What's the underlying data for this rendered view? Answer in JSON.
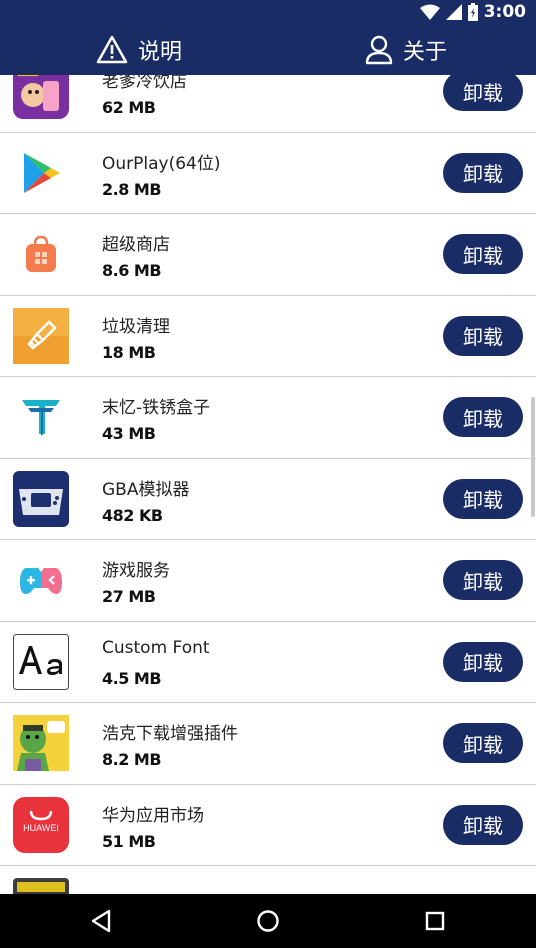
{
  "status": {
    "time": "3:00"
  },
  "header": {
    "left_label": "说明",
    "right_label": "关于"
  },
  "apps": [
    {
      "name": "老爹冷饮店",
      "size": "62 MB",
      "action": "卸载",
      "icon": "papas-cafe-icon"
    },
    {
      "name": "OurPlay(64位)",
      "size": "2.8 MB",
      "action": "卸载",
      "icon": "play-triangle-icon"
    },
    {
      "name": "超级商店",
      "size": "8.6 MB",
      "action": "卸载",
      "icon": "shopping-bag-icon"
    },
    {
      "name": "垃圾清理",
      "size": "18 MB",
      "action": "卸载",
      "icon": "broom-icon"
    },
    {
      "name": "末忆-铁锈盒子",
      "size": "43 MB",
      "action": "卸载",
      "icon": "t-logo-icon"
    },
    {
      "name": "GBA模拟器",
      "size": "482 KB",
      "action": "卸载",
      "icon": "gameboy-icon"
    },
    {
      "name": "游戏服务",
      "size": "27 MB",
      "action": "卸载",
      "icon": "gamepad-icon"
    },
    {
      "name": "Custom Font",
      "size": "4.5 MB",
      "action": "卸载",
      "icon": "font-aa-icon"
    },
    {
      "name": "浩克下载增强插件",
      "size": "8.2 MB",
      "action": "卸载",
      "icon": "hulk-icon"
    },
    {
      "name": "华为应用市场",
      "size": "51 MB",
      "action": "卸载",
      "icon": "huawei-bag-icon"
    },
    {
      "name": "",
      "size": "",
      "action": "",
      "icon": "partial-app-icon"
    }
  ],
  "icon_labels": {
    "huawei": "HUAWEI"
  },
  "colors": {
    "accent": "#1a2c66",
    "divider": "#cfcfcf"
  }
}
